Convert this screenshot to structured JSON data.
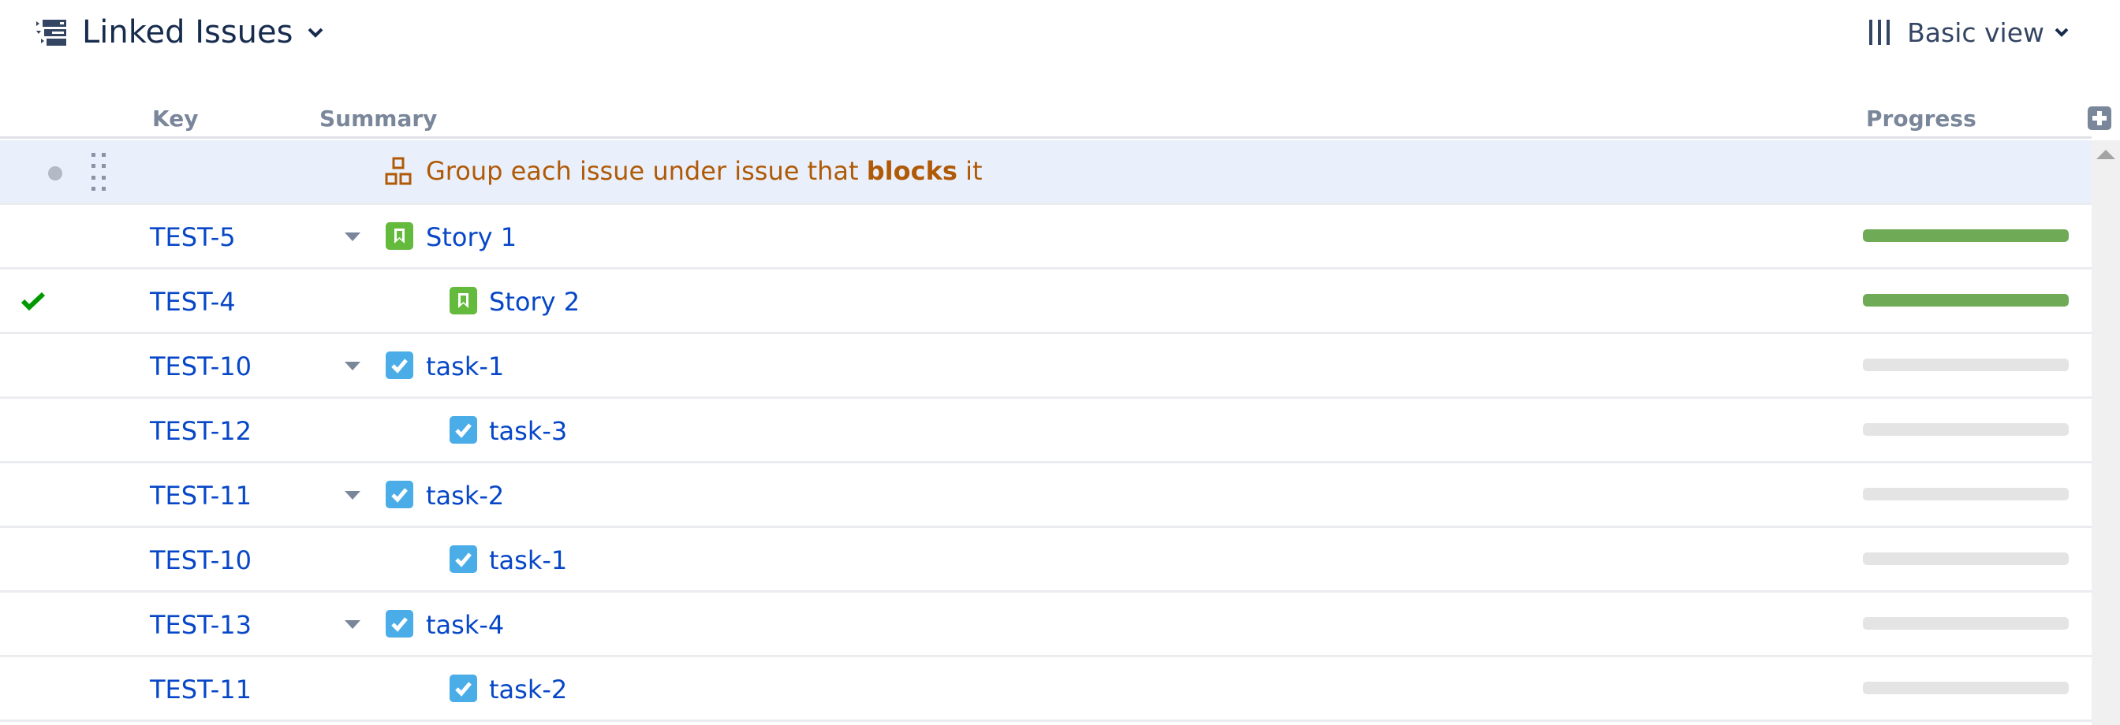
{
  "header": {
    "title": "Linked Issues",
    "title_icon": "structure-list-icon",
    "view_label": "Basic view",
    "view_icon": "columns-icon"
  },
  "columns": {
    "key": "Key",
    "summary": "Summary",
    "progress": "Progress",
    "add_column_icon": "plus-icon"
  },
  "group": {
    "prefix": "Group each issue under issue that ",
    "emphasis": "blocks",
    "suffix": " it",
    "icon": "hierarchy-icon"
  },
  "colors": {
    "link": "#0747c7",
    "group_text": "#b05a07",
    "group_bg": "#e9f0fb",
    "story": "#63ba3c",
    "task": "#4bade8",
    "progress_done": "#6fab57",
    "progress_empty": "#e4e4e4",
    "done_check": "#009900"
  },
  "rows": [
    {
      "key": "TEST-5",
      "summary": "Story 1",
      "type": "story",
      "level": 0,
      "expandable": true,
      "done": false,
      "progress": 1.0
    },
    {
      "key": "TEST-4",
      "summary": "Story 2",
      "type": "story",
      "level": 1,
      "expandable": false,
      "done": true,
      "progress": 1.0
    },
    {
      "key": "TEST-10",
      "summary": "task-1",
      "type": "task",
      "level": 0,
      "expandable": true,
      "done": false,
      "progress": 0.0
    },
    {
      "key": "TEST-12",
      "summary": "task-3",
      "type": "task",
      "level": 1,
      "expandable": false,
      "done": false,
      "progress": 0.0
    },
    {
      "key": "TEST-11",
      "summary": "task-2",
      "type": "task",
      "level": 0,
      "expandable": true,
      "done": false,
      "progress": 0.0
    },
    {
      "key": "TEST-10",
      "summary": "task-1",
      "type": "task",
      "level": 1,
      "expandable": false,
      "done": false,
      "progress": 0.0
    },
    {
      "key": "TEST-13",
      "summary": "task-4",
      "type": "task",
      "level": 0,
      "expandable": true,
      "done": false,
      "progress": 0.0
    },
    {
      "key": "TEST-11",
      "summary": "task-2",
      "type": "task",
      "level": 1,
      "expandable": false,
      "done": false,
      "progress": 0.0
    }
  ]
}
